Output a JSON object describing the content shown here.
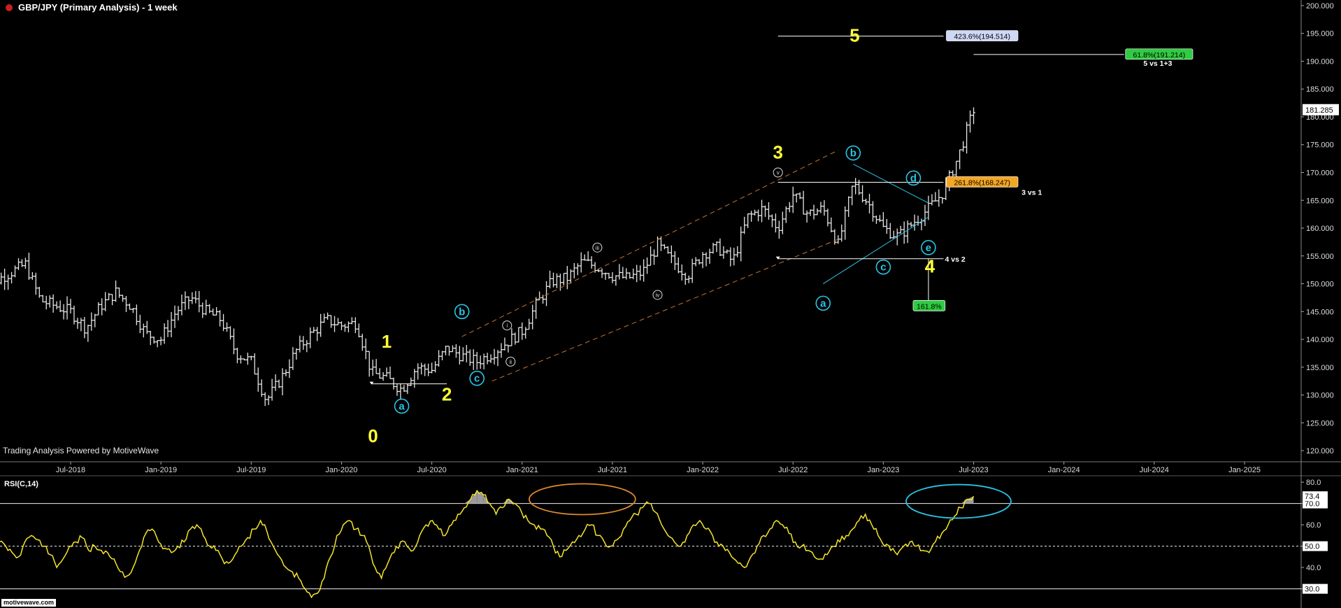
{
  "header": {
    "title": "GBP/JPY (Primary Analysis) - 1 week",
    "status_color": "#cc1f1f",
    "watermark": "Trading Analysis Powered by MotiveWave",
    "logo": "motivewave.com"
  },
  "colors": {
    "background": "#000000",
    "bars": "#e6e6e6",
    "wave_major": "#ffff33",
    "wave_minor": "#29c5e6",
    "channel": "#c8742a",
    "rsi_line": "#f5e52a",
    "badge_green": "#2ecc40",
    "badge_orange": "#f5a623",
    "badge_blue": "#cfd8f5",
    "highlight_orange": "#e08a2e",
    "highlight_cyan": "#29c5e6"
  },
  "chart_data": {
    "type": "line",
    "subtype": "ohlc-weekly",
    "symbol": "GBP/JPY",
    "timeframe": "1 week",
    "x_ticks": [
      "Jul-2018",
      "Jan-2019",
      "Jul-2019",
      "Jan-2020",
      "Jul-2020",
      "Jan-2021",
      "Jul-2021",
      "Jan-2022",
      "Jul-2022",
      "Jan-2023",
      "Jul-2023",
      "Jan-2024",
      "Jul-2024",
      "Jan-2025"
    ],
    "y_ticks": [
      "200.000",
      "195.000",
      "190.000",
      "185.000",
      "180.000",
      "175.000",
      "170.000",
      "165.000",
      "160.000",
      "155.000",
      "150.000",
      "145.000",
      "140.000",
      "135.000",
      "130.000",
      "125.000",
      "120.000"
    ],
    "ylim": [
      118,
      201
    ],
    "xlim": [
      2018.0,
      2025.1
    ],
    "last_price": "181.285",
    "price_path": [
      [
        "2018-01",
        149.0
      ],
      [
        "2018-03",
        152.0
      ],
      [
        "2018-04",
        153.5
      ],
      [
        "2018-05",
        147.0
      ],
      [
        "2018-07",
        145.0
      ],
      [
        "2018-08",
        142.0
      ],
      [
        "2018-09",
        146.0
      ],
      [
        "2018-10",
        148.5
      ],
      [
        "2018-11",
        146.0
      ],
      [
        "2018-12",
        141.0
      ],
      [
        "2019-01",
        140.0
      ],
      [
        "2019-02",
        145.0
      ],
      [
        "2019-03",
        147.5
      ],
      [
        "2019-04",
        145.0
      ],
      [
        "2019-05",
        143.5
      ],
      [
        "2019-06",
        137.5
      ],
      [
        "2019-07",
        136.0
      ],
      [
        "2019-08",
        129.0
      ],
      [
        "2019-09",
        133.0
      ],
      [
        "2019-10",
        138.0
      ],
      [
        "2019-11",
        141.0
      ],
      [
        "2019-12",
        143.5
      ],
      [
        "2020-01",
        142.5
      ],
      [
        "2020-02",
        143.0
      ],
      [
        "2020-03",
        134.0
      ],
      [
        "2020-04",
        133.0
      ],
      [
        "2020-05",
        131.0
      ],
      [
        "2020-06",
        135.0
      ],
      [
        "2020-07",
        134.5
      ],
      [
        "2020-08",
        138.5
      ],
      [
        "2020-09",
        137.0
      ],
      [
        "2020-10",
        136.0
      ],
      [
        "2020-11",
        137.5
      ],
      [
        "2020-12",
        139.5
      ],
      [
        "2021-01",
        141.5
      ],
      [
        "2021-02",
        146.5
      ],
      [
        "2021-03",
        150.5
      ],
      [
        "2021-04",
        151.0
      ],
      [
        "2021-05",
        154.0
      ],
      [
        "2021-06",
        153.0
      ],
      [
        "2021-07",
        151.5
      ],
      [
        "2021-08",
        151.0
      ],
      [
        "2021-09",
        152.0
      ],
      [
        "2021-10",
        157.0
      ],
      [
        "2021-11",
        154.0
      ],
      [
        "2021-12",
        151.5
      ],
      [
        "2022-01",
        155.5
      ],
      [
        "2022-02",
        156.5
      ],
      [
        "2022-03",
        154.0
      ],
      [
        "2022-04",
        162.0
      ],
      [
        "2022-05",
        163.5
      ],
      [
        "2022-06",
        160.0
      ],
      [
        "2022-07",
        166.0
      ],
      [
        "2022-08",
        162.5
      ],
      [
        "2022-09",
        163.5
      ],
      [
        "2022-10",
        157.0
      ],
      [
        "2022-11",
        168.0
      ],
      [
        "2022-12",
        164.5
      ],
      [
        "2023-01",
        160.0
      ],
      [
        "2023-02",
        158.5
      ],
      [
        "2023-03",
        161.0
      ],
      [
        "2023-04",
        163.5
      ],
      [
        "2023-05",
        166.5
      ],
      [
        "2023-06",
        173.0
      ],
      [
        "2023-07",
        181.3
      ]
    ],
    "waves_major": [
      {
        "label": "0",
        "date": "2020-03",
        "price": 124.0,
        "pos": "below"
      },
      {
        "label": "1",
        "date": "2020-03",
        "price": 135.0,
        "pos": "above"
      },
      {
        "label": "2",
        "date": "2020-08",
        "price": 132.0,
        "pos": "below"
      },
      {
        "label": "3",
        "date": "2022-06",
        "price": 168.5,
        "pos": "above"
      },
      {
        "label": "4",
        "date": "2023-04",
        "price": 156.0,
        "pos": "below"
      },
      {
        "label": "5",
        "date": "2022-11",
        "price": 194.5,
        "pos": "center"
      }
    ],
    "waves_minor_circle": [
      {
        "label": "a",
        "date": "2020-05",
        "price": 129.5,
        "pos": "below"
      },
      {
        "label": "b",
        "date": "2020-09",
        "price": 143.5,
        "pos": "above"
      },
      {
        "label": "c",
        "date": "2020-10",
        "price": 133.0,
        "pos": "below"
      },
      {
        "label": "a",
        "date": "2022-09",
        "price": 149.0,
        "pos": "below"
      },
      {
        "label": "b",
        "date": "2022-11",
        "price": 172.5,
        "pos": "above"
      },
      {
        "label": "c",
        "date": "2023-01",
        "price": 155.0,
        "pos": "below"
      },
      {
        "label": "d",
        "date": "2023-03",
        "price": 169.0,
        "pos": "center"
      },
      {
        "label": "e",
        "date": "2023-04",
        "price": 157.0,
        "pos": "below"
      }
    ],
    "waves_roman": [
      {
        "label": "i",
        "date": "2020-12",
        "price": 141.5
      },
      {
        "label": "ii",
        "date": "2020-12",
        "price": 135.5
      },
      {
        "label": "iii",
        "date": "2021-06",
        "price": 157.5
      },
      {
        "label": "iv",
        "date": "2021-10",
        "price": 149.5
      },
      {
        "label": "v",
        "date": "2022-06",
        "price": 171.0
      }
    ],
    "fib_annotations": [
      {
        "label": "423.6%(194.514)",
        "price": 194.514,
        "color": "#cfd8f5",
        "note": ""
      },
      {
        "label": "61.8%(191.214)",
        "price": 191.214,
        "color": "#2ecc40",
        "note": "5 vs 1+3"
      },
      {
        "label": "261.8%(168.247)",
        "price": 168.247,
        "color": "#f5a623",
        "note": "3 vs 1"
      },
      {
        "label": "161.8%",
        "price": 146.0,
        "color": "#2ecc40",
        "note": "4 vs 2"
      }
    ],
    "rsi": {
      "label": "RSI(C,14)",
      "y_ticks": [
        "80.0",
        "70.0",
        "60.0",
        "50.0",
        "40.0",
        "30.0"
      ],
      "ylim": [
        22,
        82
      ],
      "current": "73.4",
      "levels": [
        70,
        50,
        30
      ],
      "values": [
        48,
        55,
        58,
        52,
        50,
        47,
        45,
        52,
        55,
        53,
        50,
        46,
        40,
        44,
        50,
        52,
        54,
        48,
        50,
        48,
        47,
        44,
        38,
        36,
        40,
        48,
        56,
        58,
        52,
        49,
        47,
        50,
        52,
        58,
        60,
        55,
        50,
        48,
        44,
        42,
        46,
        50,
        54,
        58,
        62,
        57,
        50,
        45,
        40,
        38,
        35,
        30,
        26,
        28,
        35,
        45,
        55,
        60,
        62,
        58,
        55,
        50,
        40,
        35,
        42,
        47,
        52,
        50,
        48,
        55,
        60,
        62,
        58,
        55,
        60,
        65,
        68,
        72,
        76,
        74,
        70,
        65,
        68,
        72,
        70,
        66,
        62,
        60,
        58,
        55,
        50,
        45,
        48,
        52,
        55,
        58,
        60,
        55,
        52,
        50,
        53,
        58,
        62,
        65,
        68,
        70,
        66,
        60,
        55,
        52,
        50,
        55,
        60,
        62,
        58,
        55,
        50,
        48,
        45,
        42,
        40,
        45,
        50,
        55,
        58,
        62,
        60,
        56,
        52,
        50,
        48,
        45,
        44,
        46,
        50,
        52,
        55,
        58,
        62,
        65,
        60,
        55,
        50,
        48,
        46,
        50,
        52,
        50,
        48,
        47,
        52,
        56,
        60,
        64,
        68,
        72,
        73.4
      ]
    },
    "title": "GBP/JPY (Primary Analysis) - 1 week",
    "legend": "",
    "grid": false
  }
}
